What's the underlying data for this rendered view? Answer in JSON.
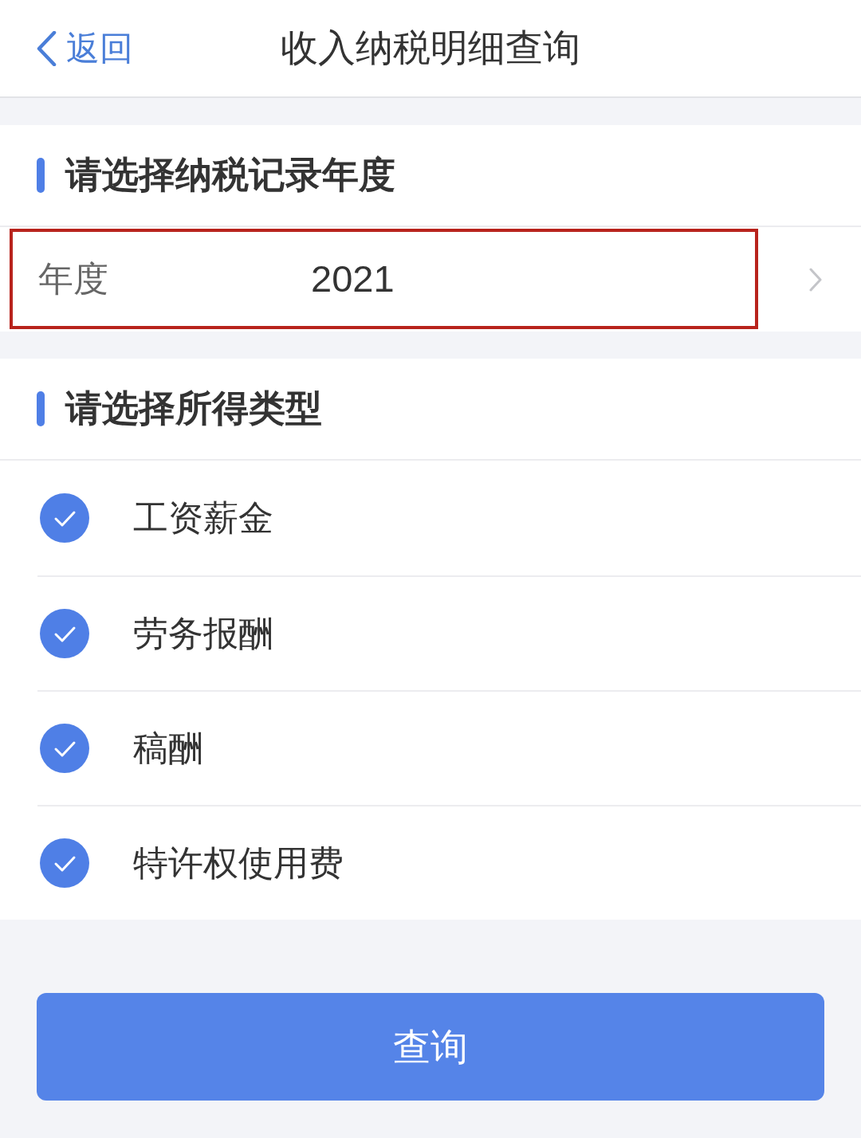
{
  "nav_bar": {
    "back_label": "返回",
    "title": "收入纳税明细查询"
  },
  "year_section": {
    "title": "请选择纳税记录年度",
    "row": {
      "label": "年度",
      "value": "2021",
      "highlighted": true
    }
  },
  "income_section": {
    "title": "请选择所得类型",
    "options": [
      {
        "label": "工资薪金",
        "checked": true
      },
      {
        "label": "劳务报酬",
        "checked": true
      },
      {
        "label": "稿酬",
        "checked": true
      },
      {
        "label": "特许权使用费",
        "checked": true
      }
    ]
  },
  "submit_button": {
    "label": "查询"
  }
}
